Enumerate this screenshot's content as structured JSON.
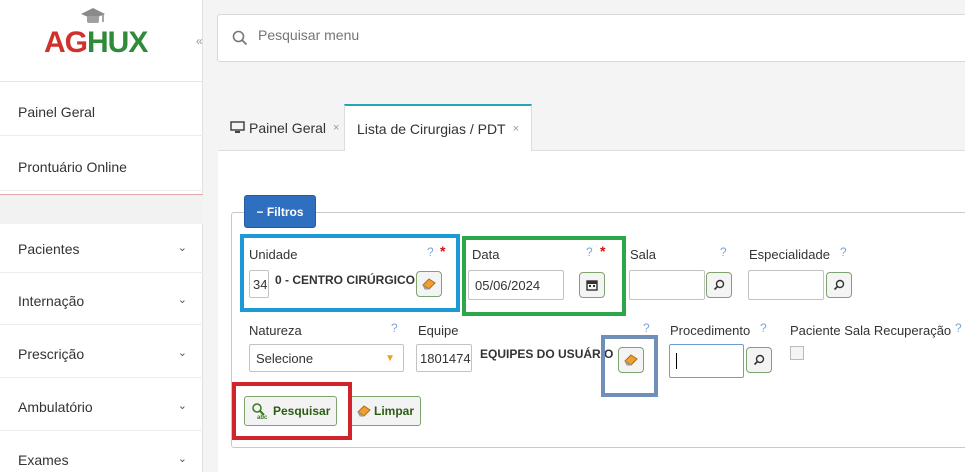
{
  "app": {
    "logo_prefix": "AG",
    "logo_suffix": "HUX"
  },
  "search": {
    "placeholder": "Pesquisar menu"
  },
  "sidebar": {
    "collapse_glyph": "«",
    "items": [
      {
        "label": "Painel Geral"
      },
      {
        "label": "Prontuário Online"
      },
      {
        "label": "Pacientes"
      },
      {
        "label": "Internação"
      },
      {
        "label": "Prescrição"
      },
      {
        "label": "Ambulatório"
      },
      {
        "label": "Exames"
      }
    ]
  },
  "tabs": [
    {
      "label": "Painel Geral",
      "icon": "monitor-icon",
      "close": "×"
    },
    {
      "label": "Lista de Cirurgias / PDT",
      "close": "×",
      "active": true
    }
  ],
  "filters": {
    "toggle_label": "Filtros",
    "toggle_glyph": "−",
    "unidade": {
      "label": "Unidade",
      "help": "?",
      "required": "*",
      "code": "34",
      "value": "0 - CENTRO CIRÚRGICO"
    },
    "data": {
      "label": "Data",
      "help": "?",
      "required": "*",
      "value": "05/06/2024"
    },
    "sala": {
      "label": "Sala",
      "help": "?"
    },
    "especialidade": {
      "label": "Especialidade",
      "help": "?"
    },
    "natureza": {
      "label": "Natureza",
      "help": "?",
      "value": "Selecione"
    },
    "equipe": {
      "label": "Equipe",
      "help": "?",
      "code": "1801474",
      "value": "EQUIPES DO USUÁRIO"
    },
    "procedimento": {
      "label": "Procedimento",
      "help": "?"
    },
    "paciente_sala_recuperacao": {
      "label": "Paciente Sala Recuperação",
      "help": "?"
    }
  },
  "actions": {
    "search_label": "Pesquisar",
    "clear_label": "Limpar"
  },
  "colors": {
    "highlight_blue": "#1d9ad6",
    "highlight_green": "#2ca84b",
    "highlight_steel": "#6f8fb8",
    "highlight_red": "#d2232a",
    "primary": "#2f6fbf"
  }
}
